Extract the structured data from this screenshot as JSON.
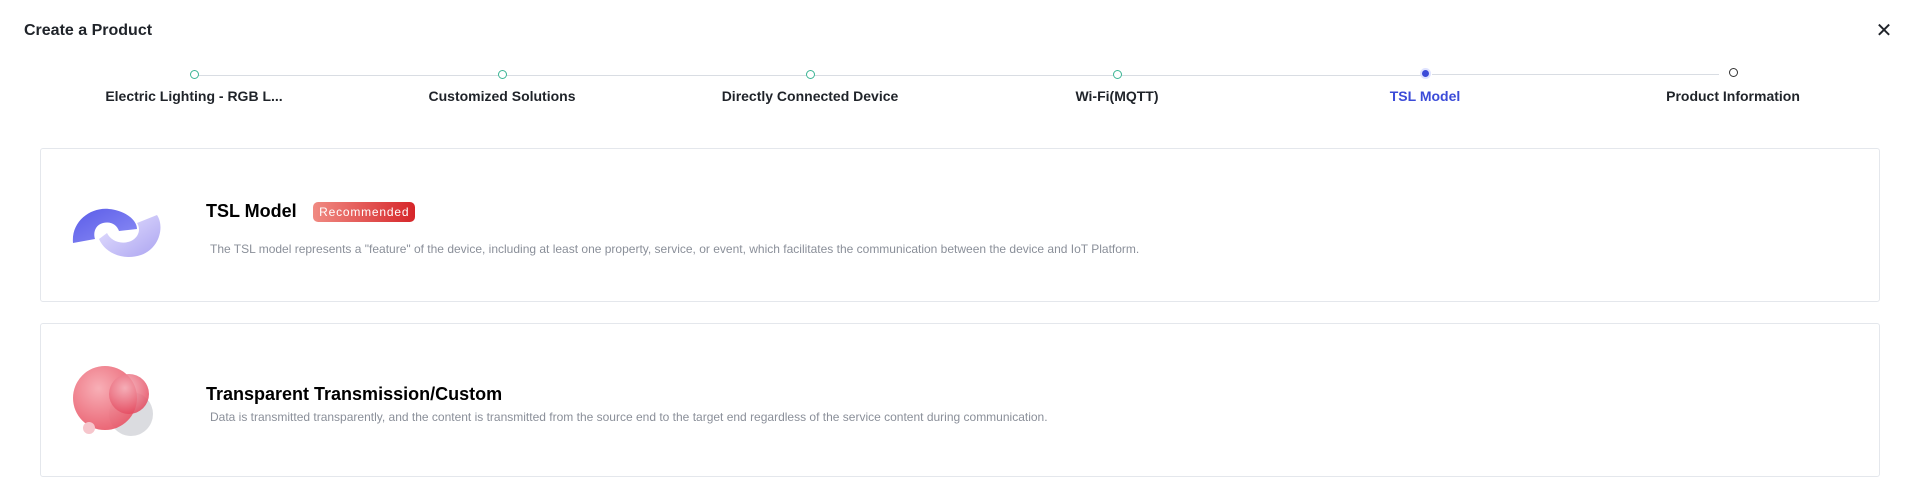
{
  "header": {
    "title": "Create a Product",
    "close_icon": "close-icon",
    "close_glyph": "✕"
  },
  "stepper": {
    "steps": [
      {
        "label": "Electric Lighting - RGB L...",
        "state": "done"
      },
      {
        "label": "Customized Solutions",
        "state": "done"
      },
      {
        "label": "Directly Connected Device",
        "state": "done"
      },
      {
        "label": "Wi-Fi(MQTT)",
        "state": "done"
      },
      {
        "label": "TSL Model",
        "state": "active"
      },
      {
        "label": "Product Information",
        "state": "pending"
      }
    ]
  },
  "options": [
    {
      "title": "TSL Model",
      "badge": "Recommended",
      "description": "The TSL model represents a \"feature\" of the device, including at least one property, service, or event, which facilitates the communication between the device and IoT Platform.",
      "icon": "tsl-model-icon"
    },
    {
      "title": "Transparent Transmission/Custom",
      "badge": "",
      "description": "Data is transmitted transparently, and the content is transmitted from the source end to the target end regardless of the service content during communication.",
      "icon": "transparent-transmission-icon"
    }
  ],
  "colors": {
    "accent": "#3b4bd8",
    "done": "#3cb595",
    "badge_start": "#f08a82",
    "badge_end": "#d6262a"
  }
}
